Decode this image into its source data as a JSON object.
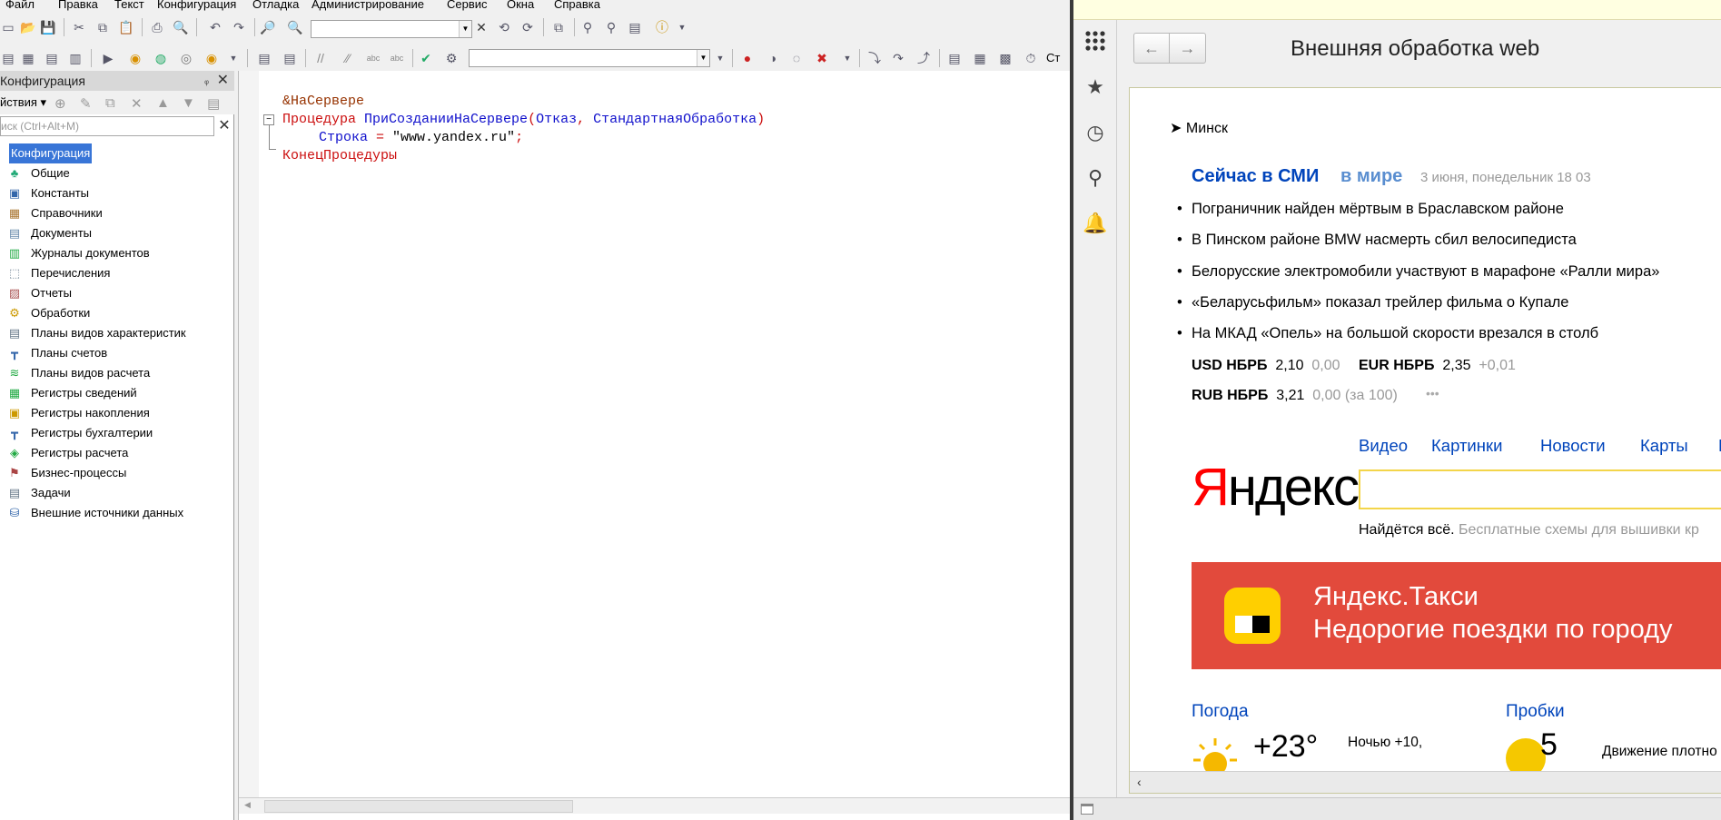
{
  "menu": [
    "Файл",
    "Правка",
    "Текст",
    "Конфигурация",
    "Отладка",
    "Администрирование",
    "Сервис",
    "Окна",
    "Справка"
  ],
  "config_panel": {
    "title": "Конфигурация",
    "pin": "ᵩ",
    "actions_label": "йствия ▾",
    "search_placeholder": "иск (Ctrl+Alt+M)",
    "items": [
      {
        "label": "Конфигурация",
        "icon": "root-icon"
      },
      {
        "label": "Общие",
        "icon": "common-icon"
      },
      {
        "label": "Константы",
        "icon": "constants-icon"
      },
      {
        "label": "Справочники",
        "icon": "catalogs-icon"
      },
      {
        "label": "Документы",
        "icon": "documents-icon"
      },
      {
        "label": "Журналы документов",
        "icon": "journals-icon"
      },
      {
        "label": "Перечисления",
        "icon": "enums-icon"
      },
      {
        "label": "Отчеты",
        "icon": "reports-icon"
      },
      {
        "label": "Обработки",
        "icon": "processors-icon"
      },
      {
        "label": "Планы видов характеристик",
        "icon": "chart-types-icon"
      },
      {
        "label": "Планы счетов",
        "icon": "accounts-icon"
      },
      {
        "label": "Планы видов расчета",
        "icon": "calc-types-icon"
      },
      {
        "label": "Регистры сведений",
        "icon": "info-registers-icon"
      },
      {
        "label": "Регистры накопления",
        "icon": "accum-registers-icon"
      },
      {
        "label": "Регистры бухгалтерии",
        "icon": "accounting-registers-icon"
      },
      {
        "label": "Регистры расчета",
        "icon": "calc-registers-icon"
      },
      {
        "label": "Бизнес-процессы",
        "icon": "bp-icon"
      },
      {
        "label": "Задачи",
        "icon": "tasks-icon"
      },
      {
        "label": "Внешние источники данных",
        "icon": "ext-sources-icon"
      }
    ]
  },
  "code": {
    "line1": "&НаСервере",
    "line2_kw": "Процедура",
    "line2_name": "ПриСозданииНаСервере",
    "line2_p1": "Отказ",
    "line2_p2": "СтандартнаяОбработка",
    "line3_var": "Строка",
    "line3_val": "\"www.yandex.ru\"",
    "line4": "КонецПроцедуры"
  },
  "toolbar_right_label": "Ст",
  "web": {
    "form_title": "Внешняя обработка web",
    "nav_back": "←",
    "nav_fwd": "→",
    "city": "Минск",
    "news_title": "Сейчас в СМИ",
    "news_tab": "в мире",
    "news_date": "3 июня, понедельник 18 03",
    "news": [
      "Пограничник найден мёртвым в Браславском районе",
      "В Пинском районе BMW насмерть сбил велосипедиста",
      "Белорусские электромобили участвуют в марафоне «Ралли мира»",
      "«Беларусьфильм» показал трейлер фильма о Купале",
      "На МКАД «Опель» на большой скорости врезался в столб"
    ],
    "rates": [
      {
        "name": "USD НБРБ",
        "value": "2,10",
        "change": "0,00"
      },
      {
        "name": "EUR НБРБ",
        "value": "2,35",
        "change": "+0,01"
      },
      {
        "name": "RUB НБРБ",
        "value": "3,21",
        "change": "0,00 (за 100)"
      }
    ],
    "more": "•••",
    "services": [
      "Видео",
      "Картинки",
      "Новости",
      "Карты",
      "М"
    ],
    "logo_first": "Я",
    "logo_rest": "ндекс",
    "found_all": "Найдётся всё.",
    "search_hint": "Бесплатные схемы для вышивки кр",
    "taxi_title": "Яндекс.Такси",
    "taxi_sub": "Недорогие поездки по городу",
    "weather_label": "Погода",
    "weather_temp": "+23°",
    "weather_night": "Ночью +10,",
    "traffic_label": "Пробки",
    "traffic_level": "5",
    "traffic_text": "Движение плотно"
  },
  "colors": {
    "accent": "#3875d7",
    "link": "#0044bb",
    "taxi": "#e24a3c",
    "logo_red": "#ff0000"
  }
}
